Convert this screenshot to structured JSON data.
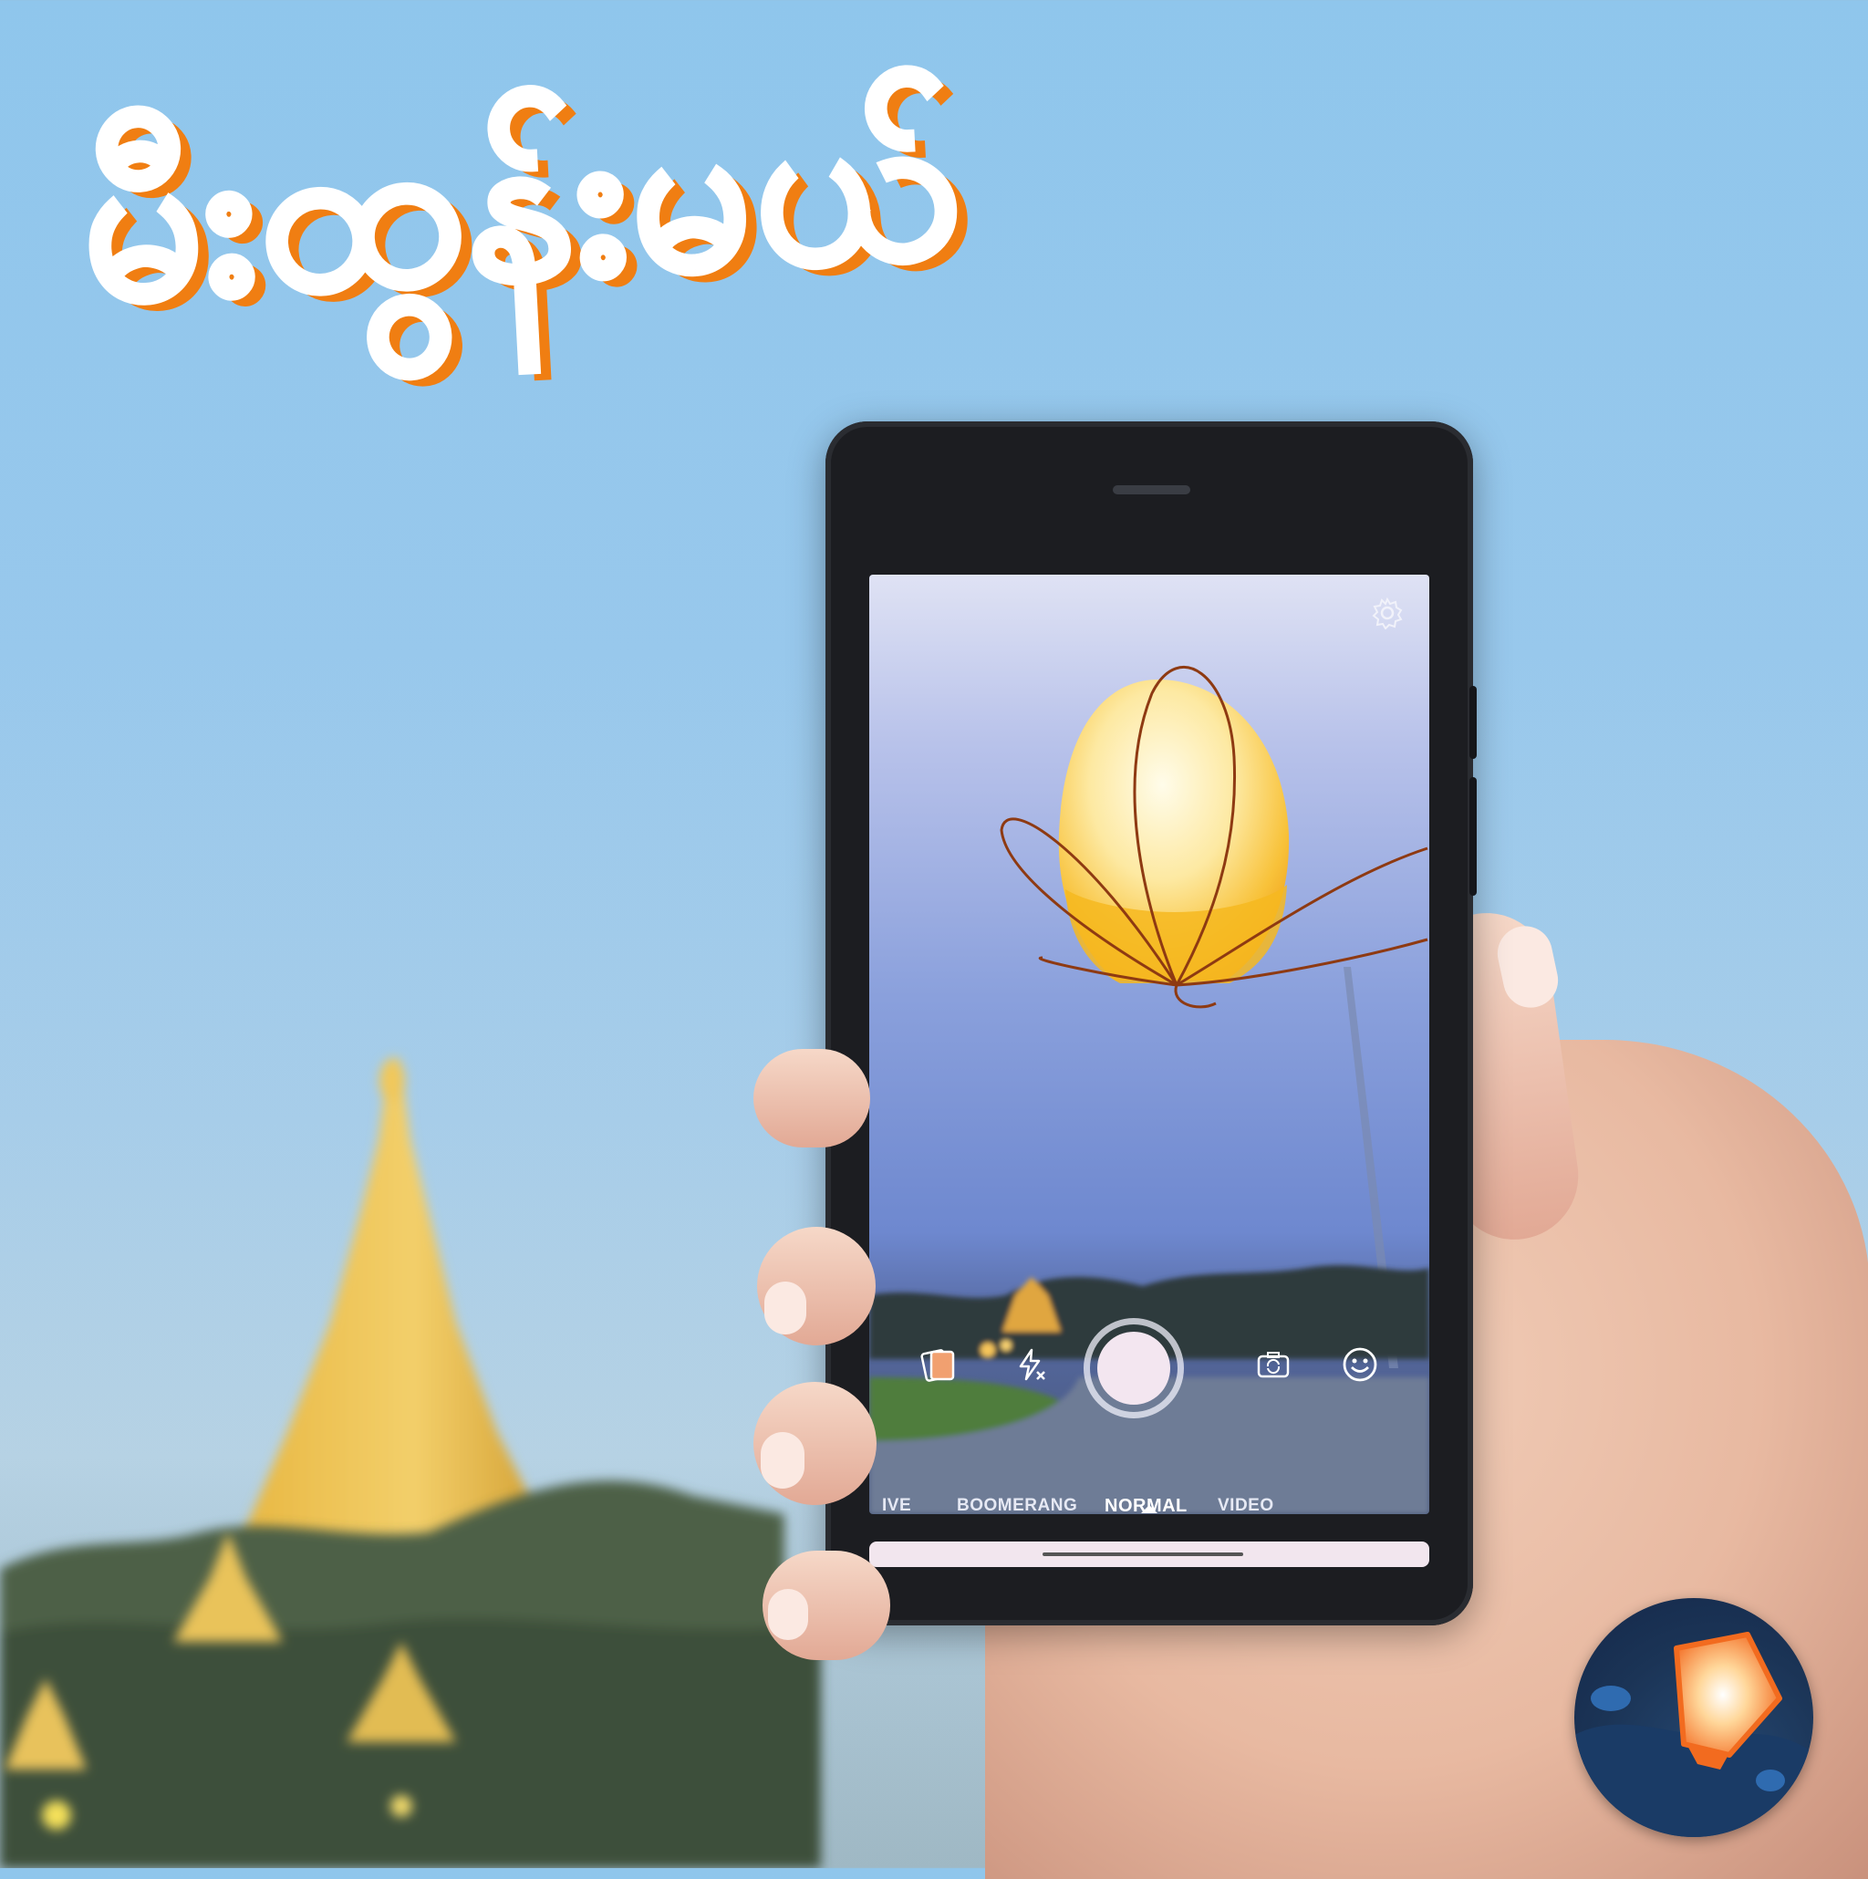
{
  "title_text": "မီးထွန်းမယ်",
  "camera": {
    "modes": [
      "IVE",
      "BOOMERANG",
      "NORMAL",
      "VIDEO"
    ],
    "active_mode": "NORMAL"
  },
  "icons": {
    "settings": "gear-icon",
    "gallery": "gallery-icon",
    "flash": "flash-off-icon",
    "shutter": "shutter-button",
    "switch_camera": "switch-camera-icon",
    "effects": "smiley-icon",
    "logo": "sky-lantern-logo"
  },
  "colors": {
    "sky": "#8fc6ec",
    "title_fill": "#f7a040",
    "title_shadow": "#f07e12",
    "phone_body": "#1c1d21",
    "lantern": "#f8c23a"
  }
}
